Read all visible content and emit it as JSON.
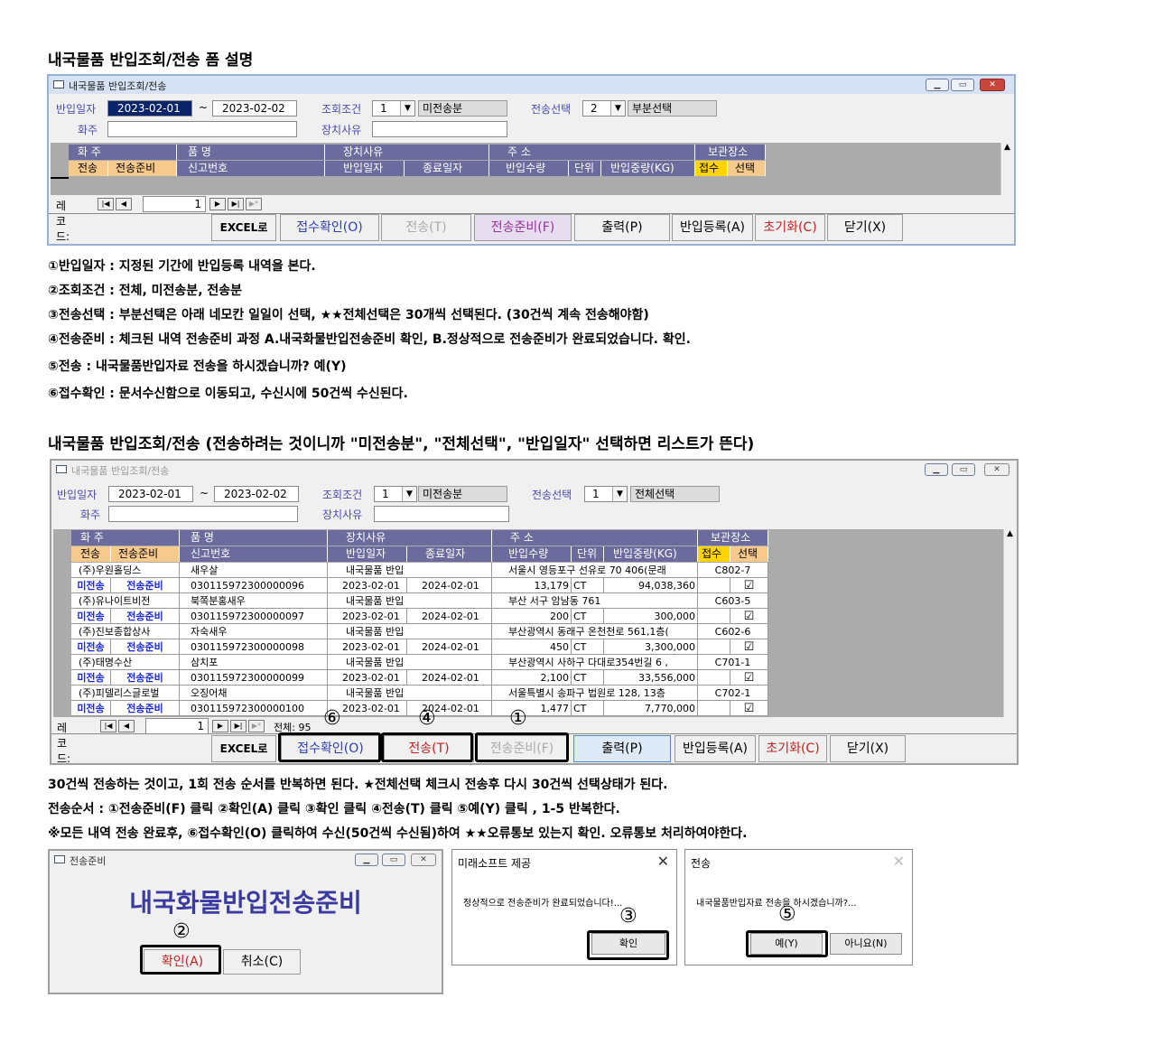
{
  "heading1": "내국물품 반입조회/전송 폼 설명",
  "heading2": "내국물품 반입조회/전송 (전송하려는 것이니까 \"미전송분\", \"전체선택\", \"반입일자\" 선택하면 리스트가 뜬다)",
  "form": {
    "title": "내국물품 반입조회/전송",
    "lbl_date": "반입일자",
    "tilde": "~",
    "lbl_owner": "화주",
    "lbl_cond": "조회조건",
    "lbl_reason": "장치사유",
    "lbl_sendsel": "전송선택",
    "record_label": "레코드:",
    "header1": [
      "화  주",
      "품  명",
      "장치사유",
      "주  소",
      "보관장소"
    ],
    "header2": [
      "전송",
      "전송준비",
      "신고번호",
      "반입일자",
      "종료일자",
      "반입수량",
      "단위",
      "반입중량(KG)",
      "접수",
      "선택"
    ],
    "buttons": [
      "EXCEL로",
      "접수확인(O)",
      "전송(T)",
      "전송준비(F)",
      "출력(P)",
      "반입등록(A)",
      "초기화(C)",
      "닫기(X)"
    ]
  },
  "form1": {
    "date_from": "2023-02-01",
    "date_to": "2023-02-02",
    "cond_code": "1",
    "cond_text": "미전송분",
    "send_code": "2",
    "send_text": "부분선택",
    "record_no": "1"
  },
  "form2": {
    "date_from": "2023-02-01",
    "date_to": "2023-02-02",
    "cond_code": "1",
    "cond_text": "미전송분",
    "send_code": "1",
    "send_text": "전체선택",
    "record_no": "1",
    "total": "전체: 95",
    "rows": [
      {
        "owner": "(주)우원홀딩스",
        "item": "새우살",
        "reason": "내국물품 반입",
        "addr": "서울시 영등포구 선유로 70 406(문래",
        "loc": "C802-7",
        "status": "미전송",
        "prep": "전송준비",
        "decl": "030115972300000096",
        "in_date": "2023-02-01",
        "end_date": "2024-02-01",
        "qty": "13,179",
        "unit": "CT",
        "weight": "94,038,360",
        "check": "☑"
      },
      {
        "owner": "(주)유나이트비전",
        "item": "북쪽분홍새우",
        "reason": "내국물품 반입",
        "addr": "부산 서구 암남동 761",
        "loc": "C603-5",
        "status": "미전송",
        "prep": "전송준비",
        "decl": "030115972300000097",
        "in_date": "2023-02-01",
        "end_date": "2024-02-01",
        "qty": "200",
        "unit": "CT",
        "weight": "300,000",
        "check": "☑"
      },
      {
        "owner": "(주)진보종합상사",
        "item": "자숙새우",
        "reason": "내국물품 반입",
        "addr": "부산광역시 동래구 온천천로 561,1층(",
        "loc": "C602-6",
        "status": "미전송",
        "prep": "전송준비",
        "decl": "030115972300000098",
        "in_date": "2023-02-01",
        "end_date": "2024-02-01",
        "qty": "450",
        "unit": "CT",
        "weight": "3,300,000",
        "check": "☑"
      },
      {
        "owner": "(주)태명수산",
        "item": "삼치포",
        "reason": "내국물품 반입",
        "addr": "부산광역시 사하구 다대로354번길 6 ,",
        "loc": "C701-1",
        "status": "미전송",
        "prep": "전송준비",
        "decl": "030115972300000099",
        "in_date": "2023-02-01",
        "end_date": "2024-02-01",
        "qty": "2,100",
        "unit": "CT",
        "weight": "33,556,000",
        "check": "☑"
      },
      {
        "owner": "(주)피델리스글로벌",
        "item": "오징어채",
        "reason": "내국물품 반입",
        "addr": "서울특별시 송파구 법원로 128, 13층",
        "loc": "C702-1",
        "status": "미전송",
        "prep": "전송준비",
        "decl": "030115972300000100",
        "in_date": "2023-02-01",
        "end_date": "2024-02-01",
        "qty": "1,477",
        "unit": "CT",
        "weight": "7,770,000",
        "check": "☑"
      }
    ]
  },
  "notes1": [
    "①반입일자 : 지정된 기간에 반입등록 내역을 본다.",
    "②조회조건 : 전체, 미전송분, 전송분",
    "③전송선택 : 부분선택은 아래 네모칸 일일이 선택, ★★전체선택은 30개씩 선택된다. (30건씩 계속 전송해야함)",
    "④전송준비 : 체크된 내역 전송준비 과정 A.내국화물반입전송준비 확인, B.정상적으로 전송준비가 완료되었습니다. 확인.",
    "⑤전송 : 내국물품반입자료 전송을 하시겠습니까? 예(Y)",
    "⑥접수확인 : 문서수신함으로 이동되고, 수신시에 50건씩 수신된다."
  ],
  "notes2": [
    "30건씩 전송하는 것이고, 1회 전송 순서를 반복하면 된다. ★전체선택 체크시 전송후 다시 30건씩 선택상태가 된다.",
    "전송순서 : ①전송준비(F) 클릭 ②확인(A) 클릭 ③확인 클릭 ④전송(T) 클릭 ⑤예(Y) 클릭 , 1-5 반복한다.",
    "※모든 내역 전송 완료후, ⑥접수확인(O) 클릭하여 수신(50건씩 수신됨)하여 ★★오류통보 있는지 확인. 오류통보 처리하여야한다."
  ],
  "markers": {
    "m6": "⑥",
    "m4": "④",
    "m1": "①",
    "m2": "②",
    "m3": "③",
    "m5": "⑤"
  },
  "dlg_prep": {
    "title": "전송준비",
    "big": "내국화물반입전송준비",
    "ok": "확인(A)",
    "cancel": "취소(C)"
  },
  "dlg_ms": {
    "title": "미래소프트 제공",
    "msg": "정상적으로 전송준비가 완료되었습니다!...",
    "ok": "확인"
  },
  "dlg_send": {
    "title": "전송",
    "msg": "내국물품반입자료 전송을 하시겠습니까?...",
    "yes": "예(Y)",
    "no": "아니요(N)"
  },
  "win_buttons": {
    "min": "▁",
    "max": "▭",
    "close": "✕"
  }
}
